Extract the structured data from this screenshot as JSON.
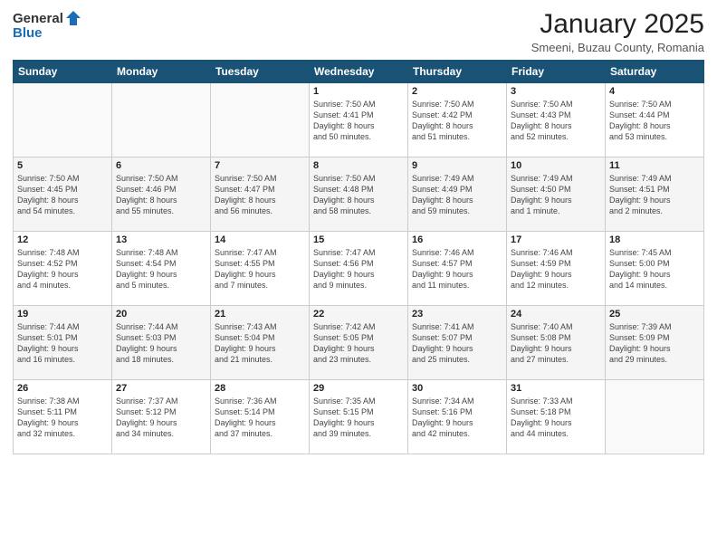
{
  "header": {
    "logo_general": "General",
    "logo_blue": "Blue",
    "month": "January 2025",
    "location": "Smeeni, Buzau County, Romania"
  },
  "days_of_week": [
    "Sunday",
    "Monday",
    "Tuesday",
    "Wednesday",
    "Thursday",
    "Friday",
    "Saturday"
  ],
  "weeks": [
    [
      {
        "day": "",
        "info": ""
      },
      {
        "day": "",
        "info": ""
      },
      {
        "day": "",
        "info": ""
      },
      {
        "day": "1",
        "info": "Sunrise: 7:50 AM\nSunset: 4:41 PM\nDaylight: 8 hours\nand 50 minutes."
      },
      {
        "day": "2",
        "info": "Sunrise: 7:50 AM\nSunset: 4:42 PM\nDaylight: 8 hours\nand 51 minutes."
      },
      {
        "day": "3",
        "info": "Sunrise: 7:50 AM\nSunset: 4:43 PM\nDaylight: 8 hours\nand 52 minutes."
      },
      {
        "day": "4",
        "info": "Sunrise: 7:50 AM\nSunset: 4:44 PM\nDaylight: 8 hours\nand 53 minutes."
      }
    ],
    [
      {
        "day": "5",
        "info": "Sunrise: 7:50 AM\nSunset: 4:45 PM\nDaylight: 8 hours\nand 54 minutes."
      },
      {
        "day": "6",
        "info": "Sunrise: 7:50 AM\nSunset: 4:46 PM\nDaylight: 8 hours\nand 55 minutes."
      },
      {
        "day": "7",
        "info": "Sunrise: 7:50 AM\nSunset: 4:47 PM\nDaylight: 8 hours\nand 56 minutes."
      },
      {
        "day": "8",
        "info": "Sunrise: 7:50 AM\nSunset: 4:48 PM\nDaylight: 8 hours\nand 58 minutes."
      },
      {
        "day": "9",
        "info": "Sunrise: 7:49 AM\nSunset: 4:49 PM\nDaylight: 8 hours\nand 59 minutes."
      },
      {
        "day": "10",
        "info": "Sunrise: 7:49 AM\nSunset: 4:50 PM\nDaylight: 9 hours\nand 1 minute."
      },
      {
        "day": "11",
        "info": "Sunrise: 7:49 AM\nSunset: 4:51 PM\nDaylight: 9 hours\nand 2 minutes."
      }
    ],
    [
      {
        "day": "12",
        "info": "Sunrise: 7:48 AM\nSunset: 4:52 PM\nDaylight: 9 hours\nand 4 minutes."
      },
      {
        "day": "13",
        "info": "Sunrise: 7:48 AM\nSunset: 4:54 PM\nDaylight: 9 hours\nand 5 minutes."
      },
      {
        "day": "14",
        "info": "Sunrise: 7:47 AM\nSunset: 4:55 PM\nDaylight: 9 hours\nand 7 minutes."
      },
      {
        "day": "15",
        "info": "Sunrise: 7:47 AM\nSunset: 4:56 PM\nDaylight: 9 hours\nand 9 minutes."
      },
      {
        "day": "16",
        "info": "Sunrise: 7:46 AM\nSunset: 4:57 PM\nDaylight: 9 hours\nand 11 minutes."
      },
      {
        "day": "17",
        "info": "Sunrise: 7:46 AM\nSunset: 4:59 PM\nDaylight: 9 hours\nand 12 minutes."
      },
      {
        "day": "18",
        "info": "Sunrise: 7:45 AM\nSunset: 5:00 PM\nDaylight: 9 hours\nand 14 minutes."
      }
    ],
    [
      {
        "day": "19",
        "info": "Sunrise: 7:44 AM\nSunset: 5:01 PM\nDaylight: 9 hours\nand 16 minutes."
      },
      {
        "day": "20",
        "info": "Sunrise: 7:44 AM\nSunset: 5:03 PM\nDaylight: 9 hours\nand 18 minutes."
      },
      {
        "day": "21",
        "info": "Sunrise: 7:43 AM\nSunset: 5:04 PM\nDaylight: 9 hours\nand 21 minutes."
      },
      {
        "day": "22",
        "info": "Sunrise: 7:42 AM\nSunset: 5:05 PM\nDaylight: 9 hours\nand 23 minutes."
      },
      {
        "day": "23",
        "info": "Sunrise: 7:41 AM\nSunset: 5:07 PM\nDaylight: 9 hours\nand 25 minutes."
      },
      {
        "day": "24",
        "info": "Sunrise: 7:40 AM\nSunset: 5:08 PM\nDaylight: 9 hours\nand 27 minutes."
      },
      {
        "day": "25",
        "info": "Sunrise: 7:39 AM\nSunset: 5:09 PM\nDaylight: 9 hours\nand 29 minutes."
      }
    ],
    [
      {
        "day": "26",
        "info": "Sunrise: 7:38 AM\nSunset: 5:11 PM\nDaylight: 9 hours\nand 32 minutes."
      },
      {
        "day": "27",
        "info": "Sunrise: 7:37 AM\nSunset: 5:12 PM\nDaylight: 9 hours\nand 34 minutes."
      },
      {
        "day": "28",
        "info": "Sunrise: 7:36 AM\nSunset: 5:14 PM\nDaylight: 9 hours\nand 37 minutes."
      },
      {
        "day": "29",
        "info": "Sunrise: 7:35 AM\nSunset: 5:15 PM\nDaylight: 9 hours\nand 39 minutes."
      },
      {
        "day": "30",
        "info": "Sunrise: 7:34 AM\nSunset: 5:16 PM\nDaylight: 9 hours\nand 42 minutes."
      },
      {
        "day": "31",
        "info": "Sunrise: 7:33 AM\nSunset: 5:18 PM\nDaylight: 9 hours\nand 44 minutes."
      },
      {
        "day": "",
        "info": ""
      }
    ]
  ]
}
